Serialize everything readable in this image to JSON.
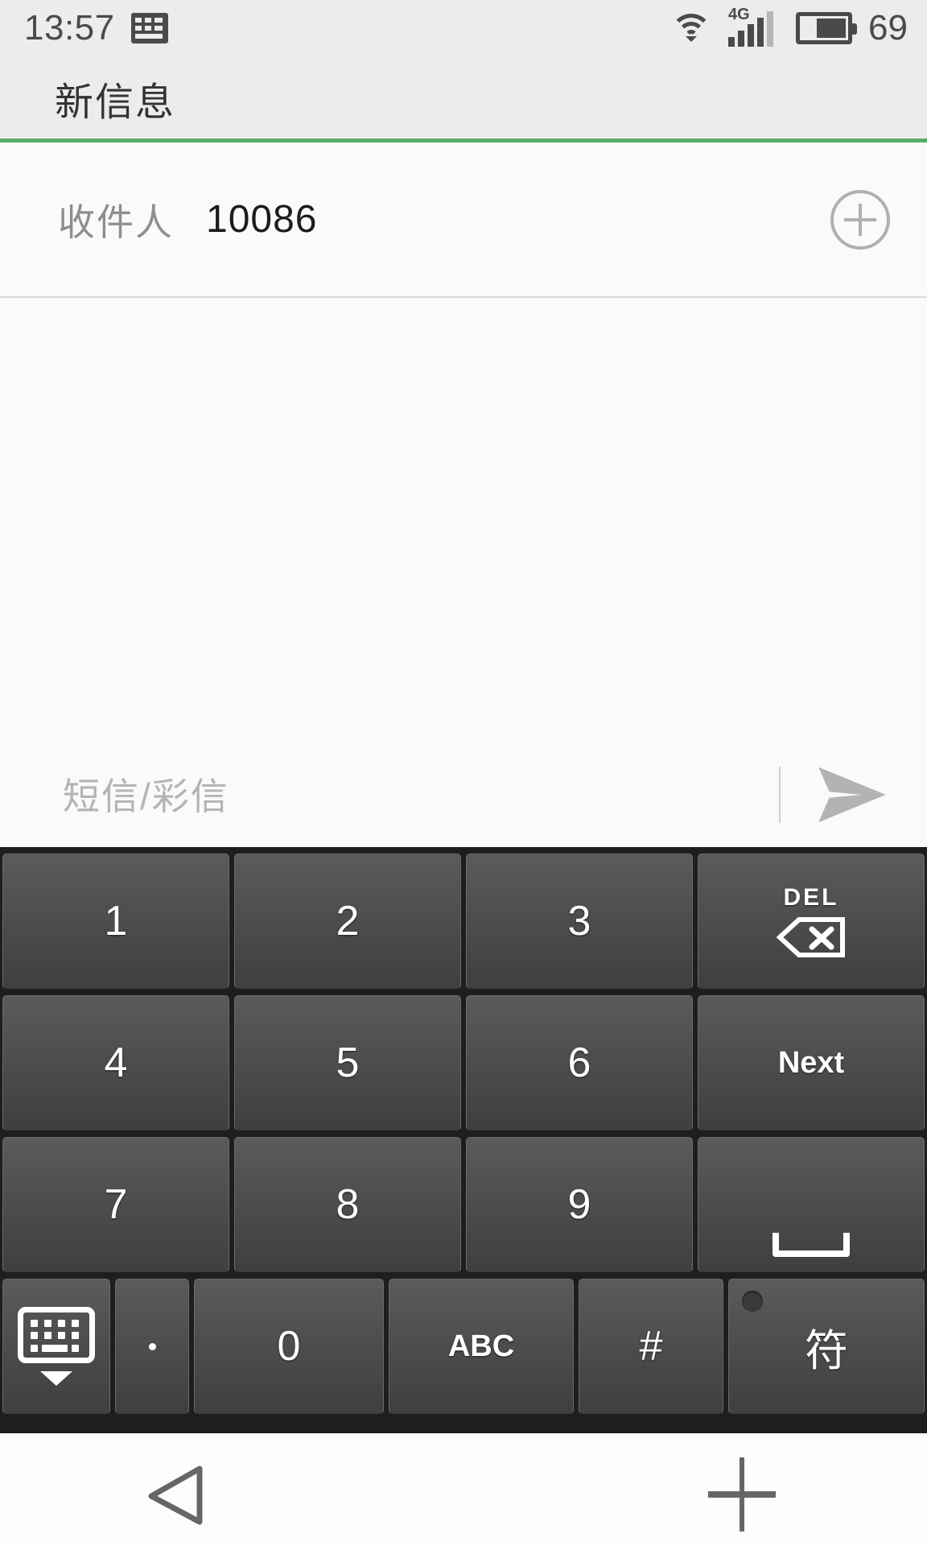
{
  "status_bar": {
    "clock": "13:57",
    "keyboard_icon": "keyboard-icon",
    "wifi_icon": "wifi-icon",
    "network_label": "4G",
    "signal_icon": "signal-bars-icon",
    "battery_icon": "battery-icon",
    "battery_level": "69"
  },
  "title_bar": {
    "title": "新信息",
    "accent_color": "#56ae68"
  },
  "recipient": {
    "label": "收件人",
    "value": "10086",
    "add_icon": "add-circle-icon"
  },
  "compose": {
    "placeholder": "短信/彩信",
    "send_icon": "send-icon"
  },
  "keyboard": {
    "rows": [
      [
        {
          "name": "key-1",
          "label": "1",
          "type": "digit"
        },
        {
          "name": "key-2",
          "label": "2",
          "type": "digit"
        },
        {
          "name": "key-3",
          "label": "3",
          "type": "digit"
        },
        {
          "name": "key-delete",
          "label": "DEL",
          "type": "delete"
        }
      ],
      [
        {
          "name": "key-4",
          "label": "4",
          "type": "digit"
        },
        {
          "name": "key-5",
          "label": "5",
          "type": "digit"
        },
        {
          "name": "key-6",
          "label": "6",
          "type": "digit"
        },
        {
          "name": "key-next",
          "label": "Next",
          "type": "action"
        }
      ],
      [
        {
          "name": "key-7",
          "label": "7",
          "type": "digit"
        },
        {
          "name": "key-8",
          "label": "8",
          "type": "digit"
        },
        {
          "name": "key-9",
          "label": "9",
          "type": "digit"
        },
        {
          "name": "key-space",
          "label": "",
          "type": "space"
        }
      ],
      [
        {
          "name": "key-hide-keyboard",
          "label": "",
          "type": "hide"
        },
        {
          "name": "key-period",
          "label": ".",
          "type": "dot"
        },
        {
          "name": "key-0",
          "label": "0",
          "type": "digit"
        },
        {
          "name": "key-abc",
          "label": "ABC",
          "type": "action"
        },
        {
          "name": "key-hash",
          "label": "#",
          "type": "digit"
        },
        {
          "name": "key-symbol",
          "label": "符",
          "type": "cjk"
        }
      ]
    ]
  },
  "nav_bar": {
    "back_icon": "back-triangle-icon",
    "plus_icon": "plus-icon"
  }
}
